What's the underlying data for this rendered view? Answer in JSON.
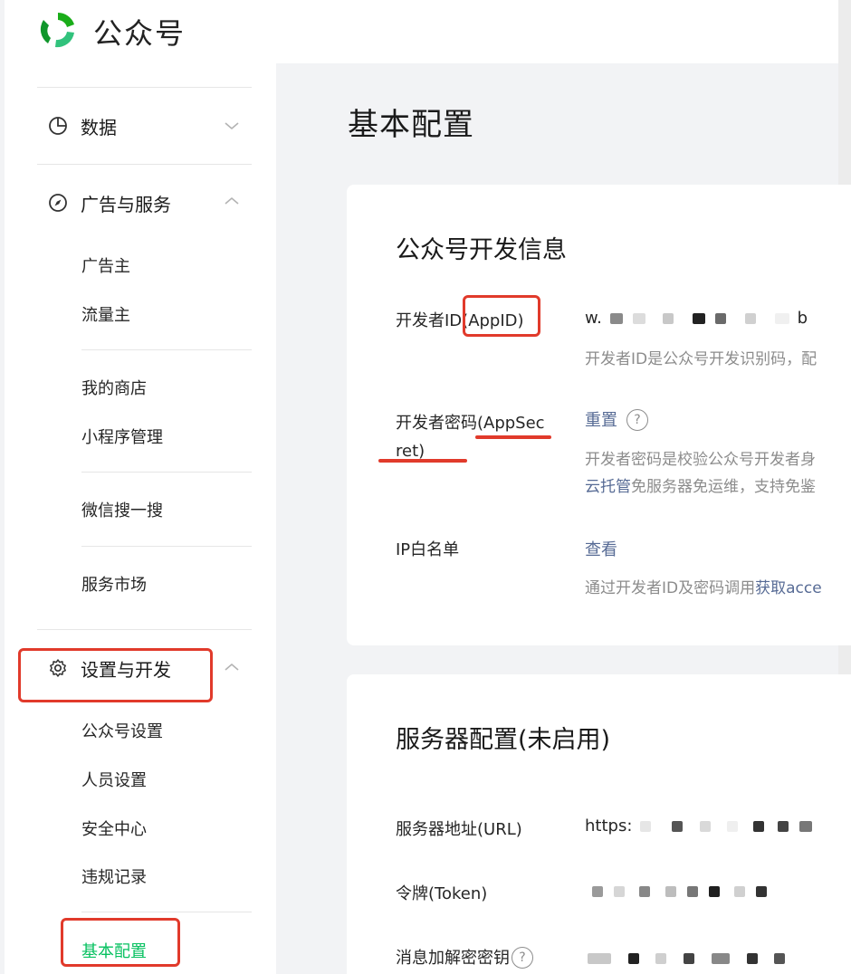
{
  "header": {
    "brand": "公众号"
  },
  "sidebar": {
    "sections": [
      {
        "label": "数据",
        "icon": "pie-chart-icon"
      },
      {
        "label": "广告与服务",
        "icon": "compass-icon",
        "items": [
          "广告主",
          "流量主",
          "我的商店",
          "小程序管理",
          "微信搜一搜",
          "服务市场"
        ]
      },
      {
        "label": "设置与开发",
        "icon": "gear-icon",
        "items": [
          "公众号设置",
          "人员设置",
          "安全中心",
          "违规记录",
          "基本配置"
        ]
      }
    ]
  },
  "main": {
    "title": "基本配置",
    "dev_card": {
      "title": "公众号开发信息",
      "appid_label_prefix": "开发者ID",
      "appid_label_suffix": "(AppID)",
      "appid_value_start": "w.",
      "appid_value_end": "b",
      "appid_desc": "开发者ID是公众号开发识别码，配",
      "secret_label": "开发者密码(AppSecret)",
      "secret_label_line1": "开发者密码(AppSec",
      "secret_label_line2": "ret)",
      "secret_action": "重置",
      "secret_desc": "开发者密码是校验公众号开发者身",
      "secret_desc2_link": "云托管",
      "secret_desc2_rest": "免服务器免运维，支持免鉴",
      "ip_label": "IP白名单",
      "ip_action": "查看",
      "ip_desc_prefix": "通过开发者ID及密码调用",
      "ip_desc_link": "获取acce"
    },
    "server_card": {
      "title": "服务器配置(未启用)",
      "url_label": "服务器地址(URL)",
      "url_value_start": "https:",
      "token_label": "令牌(Token)",
      "aes_label": "消息加解密密钥"
    }
  },
  "colors": {
    "accent_green": "#07c160",
    "link_blue": "#576b95",
    "annotation_red": "#e13a2b"
  }
}
